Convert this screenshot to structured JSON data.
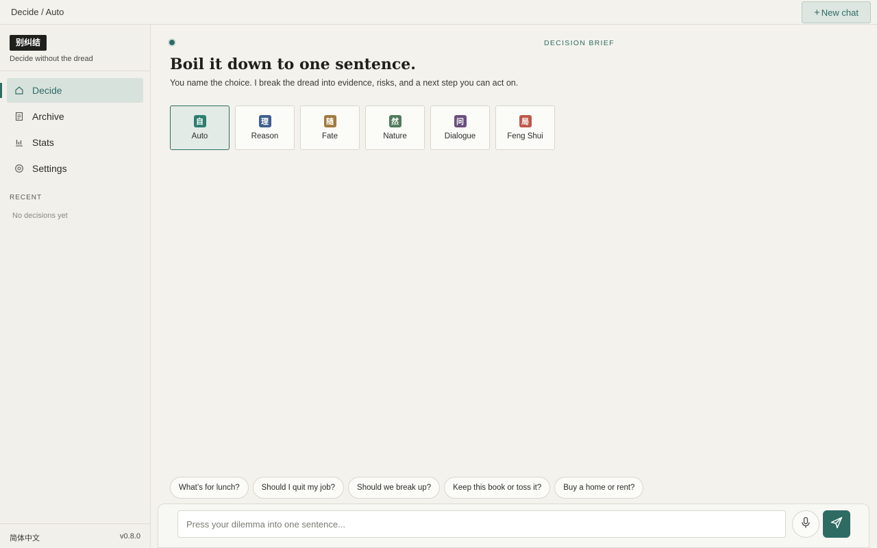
{
  "topbar": {
    "breadcrumb": "Decide / Auto",
    "new_chat_label": "New chat"
  },
  "sidebar": {
    "brand_logo": "别纠结",
    "brand_tagline": "Decide without the dread",
    "nav": [
      {
        "label": "Decide",
        "icon": "home-icon",
        "active": true
      },
      {
        "label": "Archive",
        "icon": "document-icon",
        "active": false
      },
      {
        "label": "Stats",
        "icon": "bar-chart-icon",
        "active": false
      },
      {
        "label": "Settings",
        "icon": "gear-icon",
        "active": false
      }
    ],
    "recent_title": "RECENT",
    "recent_empty": "No decisions yet",
    "language": "简体中文",
    "version": "v0.8.0"
  },
  "main": {
    "brief_label": "DECISION BRIEF",
    "headline": "Boil it down to one sentence.",
    "subline": "You name the choice. I break the dread into evidence, risks, and a next step you can act on.",
    "modes": [
      {
        "glyph": "自",
        "label": "Auto",
        "color": "#2e7d72",
        "active": true
      },
      {
        "glyph": "理",
        "label": "Reason",
        "color": "#3f5f8f",
        "active": false
      },
      {
        "glyph": "随",
        "label": "Fate",
        "color": "#a07a3e",
        "active": false
      },
      {
        "glyph": "然",
        "label": "Nature",
        "color": "#4f7a5c",
        "active": false
      },
      {
        "glyph": "问",
        "label": "Dialogue",
        "color": "#6a4f7e",
        "active": false
      },
      {
        "glyph": "局",
        "label": "Feng Shui",
        "color": "#c0574a",
        "active": false
      }
    ],
    "suggestions": [
      "What’s for lunch?",
      "Should I quit my job?",
      "Should we break up?",
      "Keep this book or toss it?",
      "Buy a home or rent?"
    ],
    "composer": {
      "placeholder": "Press your dilemma into one sentence...",
      "value": ""
    }
  }
}
